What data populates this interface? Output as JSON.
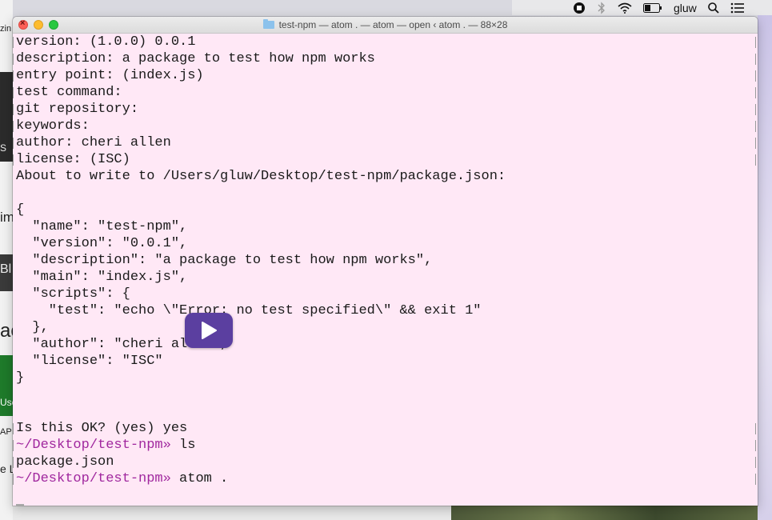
{
  "menubar": {
    "user": "gluw",
    "icons": [
      "record-icon",
      "bluetooth-icon",
      "wifi-icon",
      "battery-icon",
      "search-icon",
      "list-icon"
    ]
  },
  "window": {
    "title": "test-npm — atom . — atom — open ‹ atom . — 88×28"
  },
  "terminal": {
    "lines": [
      {
        "text": "version: (1.0.0) 0.0.1"
      },
      {
        "text": "description: a package to test how npm works"
      },
      {
        "text": "entry point: (index.js)"
      },
      {
        "text": "test command:"
      },
      {
        "text": "git repository:"
      },
      {
        "text": "keywords:"
      },
      {
        "text": "author: cheri allen"
      },
      {
        "text": "license: (ISC)"
      },
      {
        "text": "About to write to /Users/gluw/Desktop/test-npm/package.json:"
      },
      {
        "text": ""
      },
      {
        "text": "{"
      },
      {
        "text": "  \"name\": \"test-npm\","
      },
      {
        "text": "  \"version\": \"0.0.1\","
      },
      {
        "text": "  \"description\": \"a package to test how npm works\","
      },
      {
        "text": "  \"main\": \"index.js\","
      },
      {
        "text": "  \"scripts\": {"
      },
      {
        "text": "    \"test\": \"echo \\\"Error: no test specified\\\" && exit 1\""
      },
      {
        "text": "  },"
      },
      {
        "text": "  \"author\": \"cheri allen\","
      },
      {
        "text": "  \"license\": \"ISC\""
      },
      {
        "text": "}"
      },
      {
        "text": ""
      },
      {
        "text": ""
      },
      {
        "text": "Is this OK? (yes) yes"
      },
      {
        "prompt": "~/Desktop/test-npm»",
        "text": " ls"
      },
      {
        "text": "package.json"
      },
      {
        "prompt": "~/Desktop/test-npm»",
        "text": " atom ."
      }
    ]
  },
  "background": {
    "left_fragments": [
      "zin",
      "S",
      "im",
      "Bl",
      "ac",
      "Use",
      "AP",
      "e L"
    ]
  },
  "colors": {
    "terminal_bg": "#ffe8f6",
    "prompt": "#a0279e",
    "play_button": "#5b3fa0"
  }
}
